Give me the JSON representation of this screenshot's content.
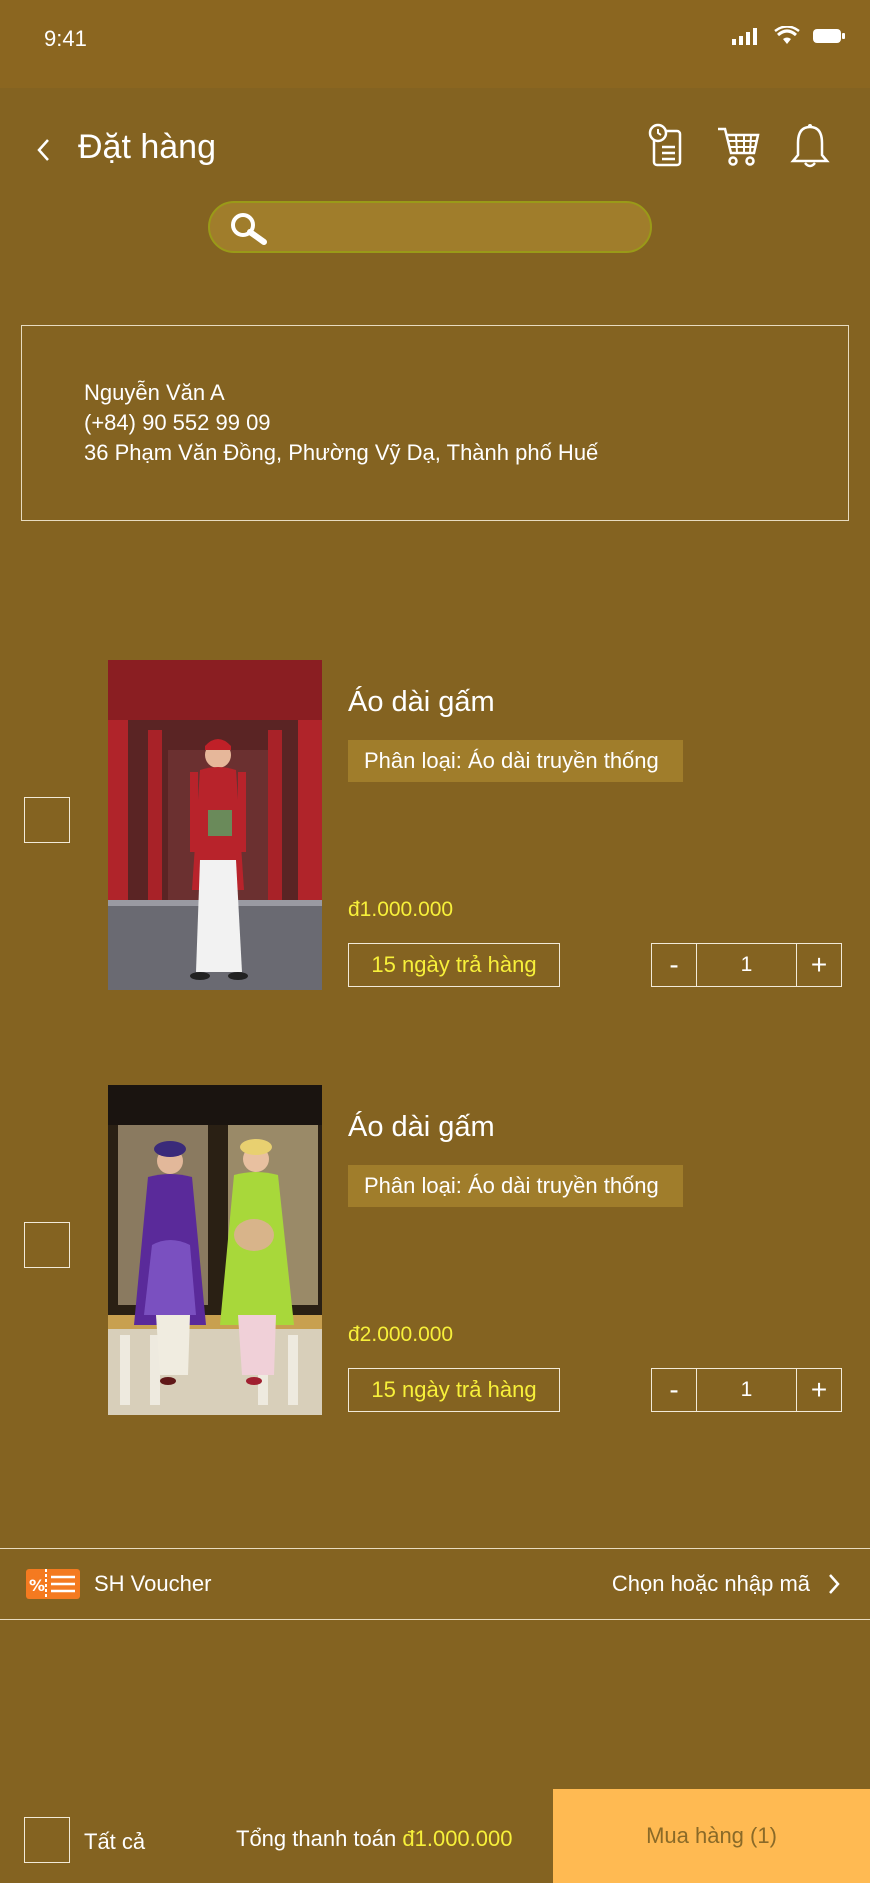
{
  "status": {
    "time": "9:41"
  },
  "header": {
    "title": "Đặt hàng"
  },
  "search": {
    "placeholder": ""
  },
  "address": {
    "name": "Nguyễn Văn A",
    "phone": "(+84) 90 552 99 09",
    "street": "36 Phạm Văn Đồng, Phường Vỹ Dạ, Thành phố Huế"
  },
  "items": [
    {
      "title": "Áo dài gấm",
      "variant": "Phân loại: Áo dài truyền thống",
      "price": "đ1.000.000",
      "returns": "15 ngày trả hàng",
      "quantity": "1",
      "minus": "-",
      "plus": "+"
    },
    {
      "title": "Áo dài gấm",
      "variant": "Phân loại: Áo dài truyền thống",
      "price": "đ2.000.000",
      "returns": "15 ngày trả hàng",
      "quantity": "1",
      "minus": "-",
      "plus": "+"
    }
  ],
  "voucher": {
    "label": "SH Voucher",
    "action": "Chọn hoặc nhập mã"
  },
  "footer": {
    "select_all": "Tất cả",
    "total_label": "Tổng thanh toán",
    "total_value": "đ1.000.000",
    "buy": "Mua hàng (1)"
  },
  "colors": {
    "background": "#846321",
    "accent_price": "#f7f03a",
    "buy_button": "#ffba52"
  }
}
